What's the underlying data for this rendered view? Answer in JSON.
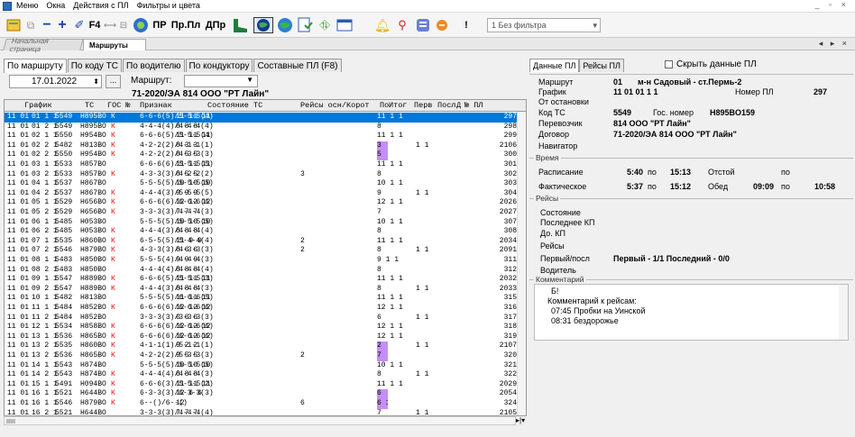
{
  "window": {
    "menu": [
      "Меню",
      "Окна",
      "Действия с ПЛ",
      "Фильтры и цвета"
    ],
    "controls": "_ ▫ ×"
  },
  "toolbar": {
    "f4": "F4",
    "pr": "ПР",
    "prpl": "Пр.Пл",
    "dpr": "ДПр",
    "exclam": "!",
    "filter_value": "1 Без фильтра"
  },
  "doc_tabs": {
    "start": "Начальная страница",
    "routes": "Маршруты",
    "nav": "◂ ▸ ×"
  },
  "tabs": [
    "По маршруту",
    "По коду ТС",
    "По водителю",
    "По кондуктору",
    "Составные ПЛ (F8)"
  ],
  "filter": {
    "date": "17.01.2022",
    "dots_button": "...",
    "route_label": "Маршрут:",
    "route_value": "▼",
    "route_info": "71-2020/ЭА 814 ООО \"РТ Лайн\""
  },
  "grid": {
    "headers": [
      "График",
      "ТС",
      "ГОС №",
      "Признак",
      "Состояние ТС",
      "Рейсы осн/Корот",
      "По",
      "Итог",
      "Перв",
      "Посл",
      "Д",
      "№ ПЛ"
    ],
    "rows": [
      [
        "11 01",
        "01 1 1",
        "5549",
        "H895BO",
        "К",
        "6-6-6(5)/5-5-5(4)",
        "11 11 11",
        "",
        "11 1 1",
        "",
        "",
        "",
        "297"
      ],
      [
        "11 01",
        "01 2 1",
        "5549",
        "H895BO",
        "К",
        "4-4-4(4)/4-4-4(4)",
        "8  8  8",
        "",
        "8",
        "",
        "",
        "",
        "298"
      ],
      [
        "11 01",
        "02 1 1",
        "5550",
        "H954BO",
        "К",
        "6-6-6(5)/5-5-5(4)",
        "11 11 11",
        "",
        "11 1 1",
        "",
        "",
        "",
        "299"
      ],
      [
        "11 01",
        "02 2 1",
        "5482",
        "H813BO",
        "К",
        "4-2-2(2)/4-1-1(1)",
        "8  3  3",
        "",
        "3",
        "",
        "1 1",
        "",
        "2106"
      ],
      [
        "11 01",
        "02 2 1",
        "5550",
        "H954BO",
        "К",
        "4-2-2(2)/4-3-3(3)",
        "8  5  5",
        "",
        "5",
        "",
        "",
        "",
        "300"
      ],
      [
        "11 01",
        "03 1 1",
        "5533",
        "H857BO",
        "",
        "6-6-6(6)/5-5-5(5)",
        "11 11 11",
        "",
        "11 1 1",
        "",
        "",
        "",
        "301"
      ],
      [
        "11 01",
        "03 2 1",
        "5533",
        "H857BO",
        "К",
        "4-3-3(3)/4-2-2(2)",
        "8  5  5",
        "3",
        "8",
        "",
        "",
        "",
        "302"
      ],
      [
        "11 01",
        "04 1 1",
        "5537",
        "H867BO",
        "",
        "5-5-5(5)/5-5-5(5)",
        "10 10 10",
        "",
        "10 1 1",
        "",
        "",
        "",
        "303"
      ],
      [
        "11 01",
        "04 2 1",
        "5537",
        "H867BO",
        "К",
        "4-4-4(3)/5-5-5(5)",
        "9  9  9",
        "",
        "9",
        "",
        "1 1",
        "",
        "304"
      ],
      [
        "11 01",
        "05 1 1",
        "5529",
        "H656BO",
        "К",
        "6-6-6(6)/6-6-6(6)",
        "12 12 12",
        "",
        "12 1 1",
        "",
        "",
        "",
        "2026"
      ],
      [
        "11 01",
        "05 2 1",
        "5529",
        "H656BO",
        "К",
        "3-3-3(3)/4-4-4(3)",
        "7  7  7",
        "",
        "7",
        "",
        "",
        "",
        "2027"
      ],
      [
        "11 01",
        "06 1 1",
        "5485",
        "H053BO",
        "",
        "5-5-5(5)/5-5-5(5)",
        "10 10 10",
        "",
        "10 1 1",
        "",
        "",
        "",
        "307"
      ],
      [
        "11 01",
        "06 2 1",
        "5485",
        "H053BO",
        "К",
        "4-4-4(3)/4-4-4(4)",
        "8  8  8",
        "",
        "8",
        "",
        "",
        "",
        "308"
      ],
      [
        "11 01",
        "07 1 1",
        "5535",
        "H860BO",
        "К",
        "6-5-5(5)/5-4-4(4)",
        "11 9  9",
        "2",
        "11 1 1",
        "",
        "",
        "",
        "2034"
      ],
      [
        "11 01",
        "07 2 1",
        "5546",
        "H879BO",
        "К",
        "4-3-3(3)/4-3-3(3)",
        "8  6  6",
        "2",
        "8",
        "",
        "1 1",
        "",
        "2091"
      ],
      [
        "11 01",
        "08 1 1",
        "5483",
        "H850BO",
        "К",
        "5-5-5(4)/4-4-4(3)",
        "9  9  9",
        "",
        "9 1 1",
        "",
        "",
        "",
        "311"
      ],
      [
        "11 01",
        "08 2 1",
        "5483",
        "H850BO",
        "",
        "4-4-4(4)/4-4-4(4)",
        "8  8  8",
        "",
        "8",
        "",
        "",
        "",
        "312"
      ],
      [
        "11 01",
        "09 1 1",
        "5547",
        "H889BO",
        "К",
        "6-6-6(5)/5-5-5(3)",
        "11 11 11",
        "",
        "11 1 1",
        "",
        "",
        "",
        "2032"
      ],
      [
        "11 01",
        "09 2 1",
        "5547",
        "H889BO",
        "К",
        "4-4-4(3)/4-4-4(3)",
        "8  8  8",
        "",
        "8",
        "",
        "1 1",
        "",
        "2033"
      ],
      [
        "11 01",
        "10 1 1",
        "5482",
        "H813BO",
        "",
        "5-5-5(5)/6-6-6(5)",
        "11 11 11",
        "",
        "11 1 1",
        "",
        "",
        "",
        "315"
      ],
      [
        "11 01",
        "11 1 1",
        "5484",
        "H852BO",
        "К",
        "6-6-6(6)/6-6-6(6)",
        "12 12 12",
        "",
        "12 1 1",
        "",
        "",
        "",
        "316"
      ],
      [
        "11 01",
        "11 2 1",
        "5484",
        "H852BO",
        "",
        "3-3-3(3)/3-3-3(3)",
        "6  6  6",
        "",
        "6",
        "",
        "1 1",
        "",
        "317"
      ],
      [
        "11 01",
        "12 1 1",
        "5534",
        "H858BO",
        "К",
        "6-6-6(6)/6-6-6(6)",
        "12 12 12",
        "",
        "12 1 1",
        "",
        "",
        "",
        "318"
      ],
      [
        "11 01",
        "13 1 1",
        "5536",
        "H865BO",
        "К",
        "6-6-6(6)/6-6-6(6)",
        "12 12 12",
        "",
        "12 1 1",
        "",
        "",
        "",
        "319"
      ],
      [
        "11 01",
        "13 2 1",
        "5535",
        "H860BO",
        "К",
        "4-1-1(1)/5-1-1(1)",
        "9  2  2",
        "",
        "2",
        "",
        "1 1",
        "",
        "2107"
      ],
      [
        "11 01",
        "13 2 1",
        "5536",
        "H865BO",
        "К",
        "4-2-2(2)/5-3-3(3)",
        "9  5  5",
        "2",
        "7",
        "",
        "",
        "",
        "320"
      ],
      [
        "11 01",
        "14 1 1",
        "5543",
        "H874BO",
        "",
        "5-5-5(5)/5-5-5(5)",
        "10 10 10",
        "",
        "10 1 1",
        "",
        "",
        "",
        "321"
      ],
      [
        "11 01",
        "14 2 1",
        "5543",
        "H874BO",
        "К",
        "4-4-4(4)/4-4-4(3)",
        "8  8  8",
        "",
        "8",
        "",
        "1 1",
        "",
        "322"
      ],
      [
        "11 01",
        "15 1 1",
        "5491",
        "H094BO",
        "К",
        "6-6-6(3)/5-5-5(2)",
        "11 11 11",
        "",
        "11 1 1",
        "",
        "",
        "",
        "2029"
      ],
      [
        "11 01",
        "16 1 1",
        "5521",
        "H644BO",
        "К",
        "6-3-3(3)/6-3-3(3)",
        "12 6  6",
        "",
        "6",
        "",
        "",
        "",
        "2054"
      ],
      [
        "11 01",
        "16 1 1",
        "5546",
        "H879BO",
        "К",
        "6--()/6--()",
        "12",
        "6",
        "6 1",
        "",
        "",
        "",
        "324"
      ],
      [
        "11 01",
        "16 2 1",
        "5521",
        "H644BO",
        "",
        "3-3-3(3)/4-4-4(4)",
        "7  7  7",
        "",
        "7",
        "",
        "1 1",
        "",
        "2105"
      ]
    ],
    "highlight_rows": [
      3,
      4,
      24,
      25,
      29,
      30
    ]
  },
  "right": {
    "tabs": [
      "Данные ПЛ",
      "Рейсы ПЛ"
    ],
    "hide_label": "Скрыть данные ПЛ",
    "info": {
      "route_l": "Маршрут",
      "route_v": "01",
      "route_name": "м-н Садовый - ст.Пермь-2",
      "schedule_l": "График",
      "schedule_v": "11 01  01 1 1",
      "pl_l": "Номер ПЛ",
      "pl_v": "297",
      "stop_l": "От остановки",
      "ts_l": "Код ТС",
      "ts_v": "5549",
      "gos_l": "Гос. номер",
      "gos_v": "H895BO159",
      "carrier_l": "Перевозчик",
      "carrier_v": "814 ООО \"РТ Лайн\"",
      "contract_l": "Договор",
      "contract_v": "71-2020/ЭА 814 ООО \"РТ Лайн\"",
      "nav_l": "Навигатор"
    },
    "time": {
      "title": "Время",
      "sched_l": "Расписание",
      "sched_from": "5:40",
      "po": "по",
      "sched_to": "15:13",
      "otstoi": "Отстой",
      "otstoi_po": "по",
      "fact_l": "Фактическое",
      "fact_from": "5:37",
      "fact_to": "15:12",
      "obed": "Обед",
      "obed_from": "09:09",
      "obed_to": "10:58"
    },
    "trips": {
      "title": "Рейсы",
      "state": "Состояние",
      "last_kp": "Последнее КП",
      "to_kp": "До. КП",
      "trips": "Рейсы",
      "first_last_l": "Первый/посл",
      "first_last_v": "Первый - 1/1  Последний - 0/0",
      "driver": "Водитель"
    },
    "comment": {
      "title": "Комментарий",
      "lines": [
        "Б!",
        "Комментарий к рейсам:",
        "07:45 Пробки на Уинской",
        "08:31 бездорожье"
      ]
    }
  }
}
